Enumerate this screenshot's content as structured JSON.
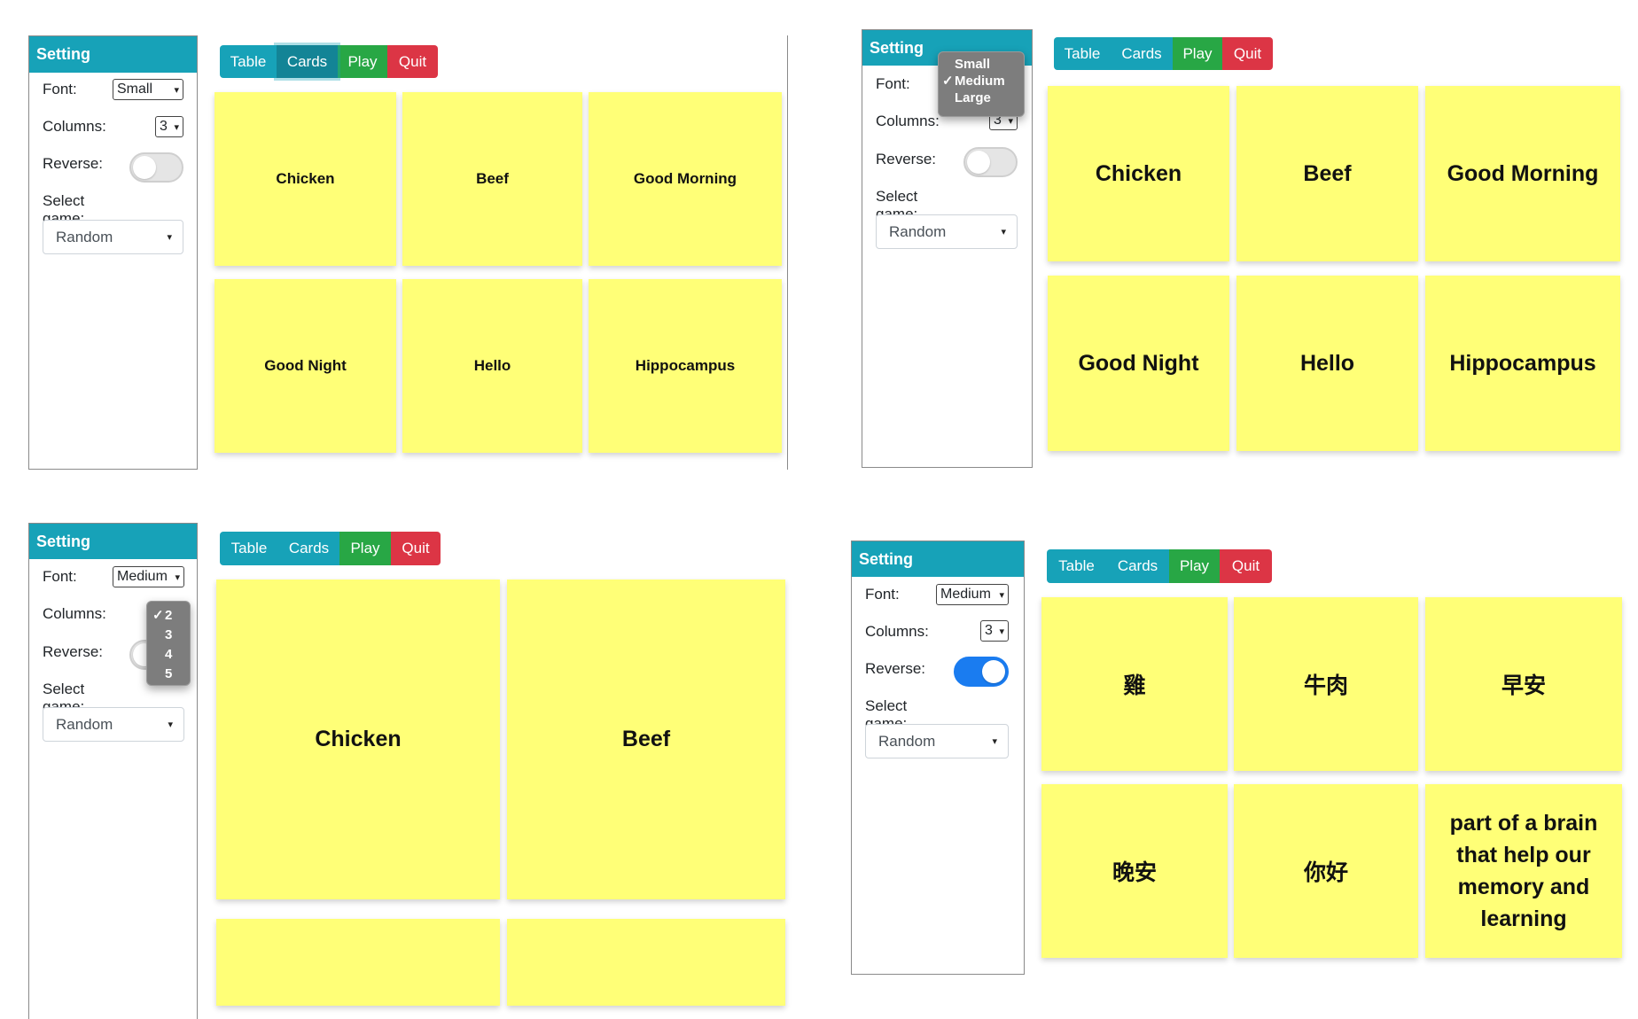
{
  "p1": {
    "setting_title": "Setting",
    "font_label": "Font:",
    "font_value": "Small",
    "columns_label": "Columns:",
    "columns_value": "3",
    "reverse_label": "Reverse:",
    "game_label": "Select game:",
    "game_value": "Random",
    "buttons": [
      "Table",
      "Cards",
      "Play",
      "Quit"
    ],
    "cards": [
      "Chicken",
      "Beef",
      "Good Morning",
      "Good Night",
      "Hello",
      "Hippocampus"
    ]
  },
  "p2": {
    "setting_title": "Setting",
    "font_label": "Font:",
    "font_options": [
      "Small",
      "Medium",
      "Large"
    ],
    "font_selected": "Medium",
    "columns_label": "Columns:",
    "columns_value": "3",
    "reverse_label": "Reverse:",
    "game_label": "Select game:",
    "game_value": "Random",
    "buttons": [
      "Table",
      "Cards",
      "Play",
      "Quit"
    ],
    "cards": [
      "Chicken",
      "Beef",
      "Good Morning",
      "Good Night",
      "Hello",
      "Hippocampus"
    ]
  },
  "p3": {
    "setting_title": "Setting",
    "font_label": "Font:",
    "font_value": "Medium",
    "columns_label": "Columns:",
    "columns_options": [
      "2",
      "3",
      "4",
      "5"
    ],
    "columns_selected": "2",
    "reverse_label": "Reverse:",
    "game_label": "Select game:",
    "game_value": "Random",
    "buttons": [
      "Table",
      "Cards",
      "Play",
      "Quit"
    ],
    "cards": [
      "Chicken",
      "Beef"
    ]
  },
  "p4": {
    "setting_title": "Setting",
    "font_label": "Font:",
    "font_value": "Medium",
    "columns_label": "Columns:",
    "columns_value": "3",
    "reverse_label": "Reverse:",
    "reverse_on": true,
    "game_label": "Select game:",
    "game_value": "Random",
    "buttons": [
      "Table",
      "Cards",
      "Play",
      "Quit"
    ],
    "cards": [
      "雞",
      "牛肉",
      "早安",
      "晚安",
      "你好",
      "part of a brain that help our memory and learning"
    ]
  },
  "check_mark": "✓",
  "chevron": "⌄",
  "colors": {
    "info": "#17a2b8",
    "success": "#28a745",
    "danger": "#dc3545",
    "card": "#ffff77",
    "toggle_on": "#1a7cf0"
  }
}
